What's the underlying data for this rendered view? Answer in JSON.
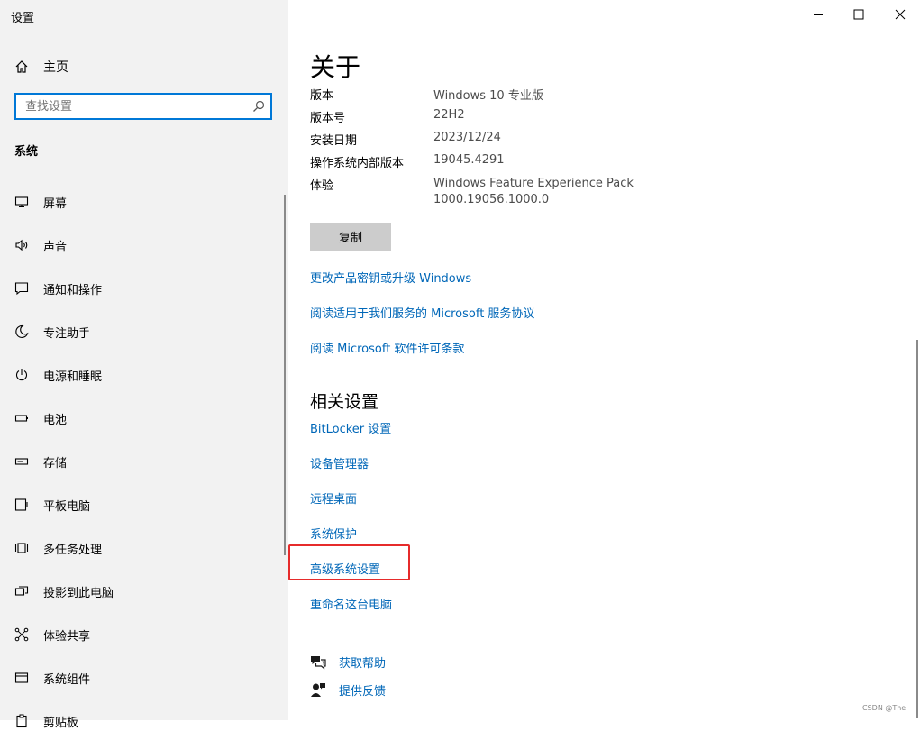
{
  "window": {
    "title": "设置"
  },
  "sidebar": {
    "home_label": "主页",
    "search_placeholder": "查找设置",
    "section_title": "系统",
    "items": [
      {
        "label": "屏幕",
        "icon": "display-icon"
      },
      {
        "label": "声音",
        "icon": "speaker-icon"
      },
      {
        "label": "通知和操作",
        "icon": "notification-icon"
      },
      {
        "label": "专注助手",
        "icon": "moon-icon"
      },
      {
        "label": "电源和睡眠",
        "icon": "power-icon"
      },
      {
        "label": "电池",
        "icon": "battery-icon"
      },
      {
        "label": "存储",
        "icon": "storage-icon"
      },
      {
        "label": "平板电脑",
        "icon": "tablet-icon"
      },
      {
        "label": "多任务处理",
        "icon": "multitask-icon"
      },
      {
        "label": "投影到此电脑",
        "icon": "project-icon"
      },
      {
        "label": "体验共享",
        "icon": "share-icon"
      },
      {
        "label": "系统组件",
        "icon": "components-icon"
      },
      {
        "label": "剪贴板",
        "icon": "clipboard-icon"
      }
    ]
  },
  "about": {
    "title": "关于",
    "specs": [
      {
        "label": "版本",
        "value": "Windows 10 专业版"
      },
      {
        "label": "版本号",
        "value": "22H2"
      },
      {
        "label": "安装日期",
        "value": "2023/12/24"
      },
      {
        "label": "操作系统内部版本",
        "value": "19045.4291"
      },
      {
        "label": "体验",
        "value": "Windows Feature Experience Pack",
        "value2": "1000.19056.1000.0"
      }
    ],
    "copy_button": "复制",
    "links": [
      "更改产品密钥或升级 Windows",
      "阅读适用于我们服务的 Microsoft 服务协议",
      "阅读 Microsoft 软件许可条款"
    ]
  },
  "related": {
    "title": "相关设置",
    "links": [
      "BitLocker 设置",
      "设备管理器",
      "远程桌面",
      "系统保护",
      "高级系统设置",
      "重命名这台电脑"
    ]
  },
  "help": {
    "get_help": "获取帮助",
    "feedback": "提供反馈"
  },
  "watermark": "CSDN @The",
  "colors": {
    "accent": "#0078d7",
    "link": "#0067b8",
    "highlight_box": "#e62b2b",
    "sidebar_bg": "#f2f2f2"
  }
}
